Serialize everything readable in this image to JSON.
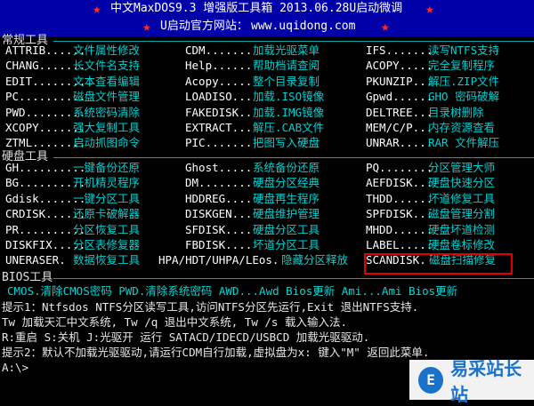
{
  "header": {
    "star_left": "★",
    "star_right": "★",
    "title": "中文MaxDOS9.3 增强版工具箱 2013.06.28U启动微调",
    "site_label": "U启动官方网站：",
    "site_url": "www.uqidong.com",
    "star2_left": "★",
    "star2_right": "★"
  },
  "sections": {
    "common": "常规工具",
    "disk": "硬盘工具",
    "bios": "BIOS工具"
  },
  "common_tools": [
    [
      "ATTRIB......",
      "文件属性修改",
      "CDM.......",
      "加载光驱菜单",
      "IFS.......",
      "读写NTFS支持"
    ],
    [
      "CHANG.......",
      "长文件名支持",
      "Help......",
      "帮助档请查阅",
      "ACOPY.....",
      "完全复制程序"
    ],
    [
      "EDIT........",
      "文本查看编辑",
      "Acopy.....",
      "整个目录复制",
      "PKUNZIP...",
      "解压.ZIP文件"
    ],
    [
      "PC..........",
      "磁盘文件管理",
      "LOADISO...",
      "加载.ISO镜像",
      "Gpwd......",
      "GHO 密码破解"
    ],
    [
      "PWD.........",
      "系统密码清除",
      "FAKEDISK..",
      "加载.IMG镜像",
      "DELTREE...",
      "目录树删除"
    ],
    [
      "XCOPY.......",
      "强大复制工具",
      "EXTRACT...",
      "解压.CAB文件",
      "MEM/C/P...",
      "内存资源查看"
    ],
    [
      "ZTML........",
      "启动抓图命令",
      "PIC.......",
      "把图写入硬盘",
      "UNRAR.....",
      "RAR 文件解压"
    ]
  ],
  "disk_tools": [
    [
      "GH..........",
      "一键备份还原",
      "Ghost.....",
      "系统备份还原",
      "PQ........",
      "分区管理大师"
    ],
    [
      "BG..........",
      "开机精灵程序",
      "DM........",
      "硬盘分区经典",
      "AEFDISK...",
      "硬盘快速分区"
    ],
    [
      "Gdisk.......",
      "一键分区工具",
      "HDDREG....",
      "硬盘再生程序",
      "THDD......",
      "坏道修复工具"
    ],
    [
      "CRDISK......",
      "还原卡破解器",
      "DISKGEN...",
      "硬盘维护管理",
      "SPFDISK...",
      "磁盘管理分割"
    ],
    [
      "PR..........",
      "分区恢复工具",
      "SFDISK....",
      "硬盘分区工具",
      "MHDD......",
      "硬盘坏道检测"
    ],
    [
      "DISKFIX.....",
      "分区表修复器",
      "FBDISK....",
      "坏道分区工具",
      "LABEL.....",
      "硬盘卷标修改"
    ],
    [
      "UNERASER.",
      "数据恢复工具",
      "HPA/HDT/UHPA/LEos.",
      "隐藏分区释放",
      "SCANDISK.",
      "磁盘扫描修复"
    ]
  ],
  "bios_line": "CMOS.清除CMOS密码  PWD.清除系统密码  AWD...Awd Bios更新  Ami...Ami Bios更新",
  "hints": [
    "提示1：Ntfsdos  NTFS分区读写工具,访问NTFS分区先运行,Exit 退出NTFS支持.",
    "  Tw 加载天汇中文系统, Tw /q 退出中文系统,  Tw /s 载入输入法.",
    "  R:重启  S:关机   J:光驱开   运行 SATACD/IDECD/USBCD 加载光驱驱动.",
    "提示2：默认不加载光驱驱动,请运行CDM自行加载,虚拟盘为x:  键入\"M\" 返回此菜单."
  ],
  "prompt": "A:\\>",
  "watermark": {
    "mark": "E",
    "text": "易采站长站"
  }
}
